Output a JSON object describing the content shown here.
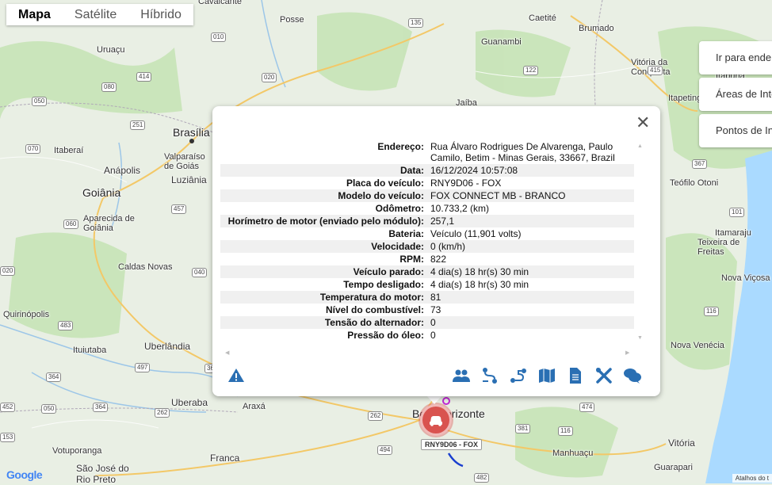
{
  "map_type": {
    "options": [
      "Mapa",
      "Satélite",
      "Híbrido"
    ],
    "active": "Mapa"
  },
  "side_buttons": [
    "Ir para endereço",
    "Áreas de Interesse",
    "Pontos de Interesse"
  ],
  "map_labels": {
    "cities": [
      {
        "name": "Brasília",
        "big": true
      },
      {
        "name": "Goiânia",
        "big": true
      },
      {
        "name": "Belo Horizonte",
        "big": true
      },
      {
        "name": "Uruaçu"
      },
      {
        "name": "Posse"
      },
      {
        "name": "Caetité"
      },
      {
        "name": "Brumado"
      },
      {
        "name": "Guanambi"
      },
      {
        "name": "Vitória da Conquista"
      },
      {
        "name": "Itabuna"
      },
      {
        "name": "Itapetinga"
      },
      {
        "name": "Itaberaí"
      },
      {
        "name": "Valparaíso de Goiás"
      },
      {
        "name": "Anápolis"
      },
      {
        "name": "Luziânia"
      },
      {
        "name": "Aparecida de Goiânia"
      },
      {
        "name": "Caldas Novas"
      },
      {
        "name": "Quirinópolis"
      },
      {
        "name": "Ituiutaba"
      },
      {
        "name": "Uberlândia"
      },
      {
        "name": "Uberaba"
      },
      {
        "name": "Araxá"
      },
      {
        "name": "Franca"
      },
      {
        "name": "São José do Rio Preto"
      },
      {
        "name": "Votuporanga"
      },
      {
        "name": "Manhuaçu"
      },
      {
        "name": "Vitória"
      },
      {
        "name": "Guarapari"
      },
      {
        "name": "Nova Venécia"
      },
      {
        "name": "Nova Viçosa"
      },
      {
        "name": "Teixeira de Freitas"
      },
      {
        "name": "Itamaraju"
      },
      {
        "name": "Teófilo Otoni"
      },
      {
        "name": "Jaíba"
      },
      {
        "name": "Cavalcante"
      }
    ],
    "shields": [
      "010",
      "135",
      "020",
      "122",
      "415",
      "414",
      "080",
      "251",
      "070",
      "050",
      "457",
      "060",
      "020",
      "040",
      "483",
      "497",
      "365",
      "364",
      "262",
      "482",
      "474",
      "116",
      "101",
      "367",
      "262",
      "494",
      "116",
      "381",
      "153",
      "364",
      "050",
      "452"
    ]
  },
  "popup": {
    "close_symbol": "✕",
    "rows": [
      {
        "key": "Endereço:",
        "value": "Rua Álvaro Rodrigues De Alvarenga, Paulo Camilo, Betim - Minas Gerais, 33667, Brazil"
      },
      {
        "key": "Data:",
        "value": "16/12/2024 10:57:08"
      },
      {
        "key": "Placa do veículo:",
        "value": "RNY9D06 - FOX"
      },
      {
        "key": "Modelo do veículo:",
        "value": "FOX CONNECT MB - BRANCO"
      },
      {
        "key": "Odômetro:",
        "value": "10.733,2 (km)"
      },
      {
        "key": "Horímetro de motor (enviado pelo módulo):",
        "value": "257,1"
      },
      {
        "key": "Bateria:",
        "value": "Veículo (11,901 volts)"
      },
      {
        "key": "Velocidade:",
        "value": "0 (km/h)"
      },
      {
        "key": "RPM:",
        "value": "822"
      },
      {
        "key": "Veículo parado:",
        "value": "4 dia(s) 18 hr(s) 30 min"
      },
      {
        "key": "Tempo desligado:",
        "value": "4 dia(s) 18 hr(s) 30 min"
      },
      {
        "key": "Temperatura do motor:",
        "value": "81"
      },
      {
        "key": "Nível do combustível:",
        "value": "73"
      },
      {
        "key": "Tensão do alternador:",
        "value": "0"
      },
      {
        "key": "Pressão do óleo:",
        "value": "0"
      }
    ],
    "action_icons": [
      "warning-icon",
      "users-icon",
      "route-icon",
      "route-alt-icon",
      "map-icon",
      "document-icon",
      "tools-icon",
      "chat-icon"
    ]
  },
  "marker": {
    "plate_label": "RNY9D06 - FOX",
    "color": "#d9534f"
  },
  "attribution": "Atalhos do t",
  "google_logo": "Google",
  "colors": {
    "icon_blue": "#2a6fb3",
    "water": "#aadaff",
    "land": "#e8f0e3",
    "green": "#bfe0b0"
  }
}
